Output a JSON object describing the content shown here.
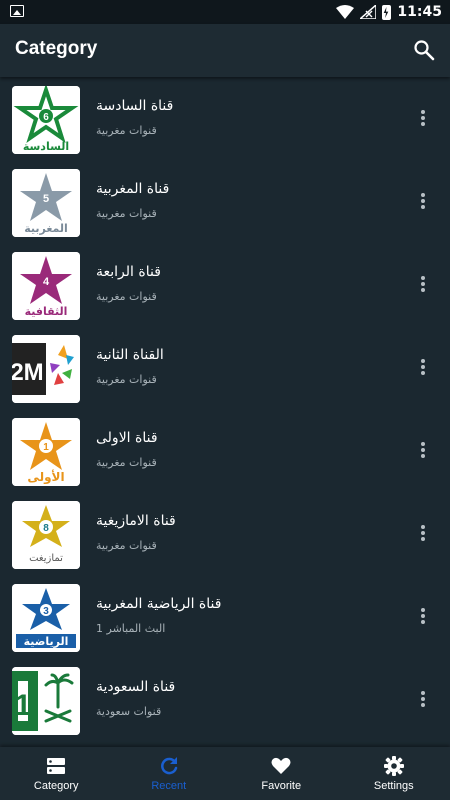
{
  "status": {
    "time": "11:45"
  },
  "appbar": {
    "title": "Category",
    "search_icon": "search-icon"
  },
  "channels": [
    {
      "name": "قناة السادسة",
      "subtitle": "قنوات مغربية",
      "logo_number": "6",
      "logo_text": "السادسة",
      "color": "#1a8a3a"
    },
    {
      "name": "قناة المغربية",
      "subtitle": "قنوات مغربية",
      "logo_number": "5",
      "logo_text": "المغربية",
      "color": "#8a9aa8"
    },
    {
      "name": "قناة الرابعة",
      "subtitle": "قنوات مغربية",
      "logo_number": "4",
      "logo_text": "الثقافية",
      "color": "#9a2a7a"
    },
    {
      "name": "القناة الثانية",
      "subtitle": "قنوات مغربية",
      "logo_text": "2M",
      "color": "#222222"
    },
    {
      "name": "قناة الاولى",
      "subtitle": "قنوات مغربية",
      "logo_number": "1",
      "logo_text": "الأولى",
      "color": "#e8941a"
    },
    {
      "name": "قناة الامازيغية",
      "subtitle": "قنوات مغربية",
      "logo_number": "8",
      "logo_text": "تمازيغت",
      "color": "#d4b01a"
    },
    {
      "name": "قناة الرياضية المغربية",
      "subtitle": "البث المباشر 1",
      "logo_number": "3",
      "logo_text": "الرياضية",
      "color": "#1a5fa8"
    },
    {
      "name": "قناة السعودية",
      "subtitle": "قنوات سعودية",
      "logo_number": "1",
      "color": "#1a7a3a"
    }
  ],
  "bottom_nav": [
    {
      "label": "Category",
      "icon": "category-icon",
      "active": false
    },
    {
      "label": "Recent",
      "icon": "refresh-icon",
      "active": true
    },
    {
      "label": "Favorite",
      "icon": "heart-icon",
      "active": false
    },
    {
      "label": "Settings",
      "icon": "gear-icon",
      "active": false
    }
  ],
  "colors": {
    "background": "#1b2830",
    "appbar": "#1e2b33",
    "accent": "#1a5fd0"
  }
}
